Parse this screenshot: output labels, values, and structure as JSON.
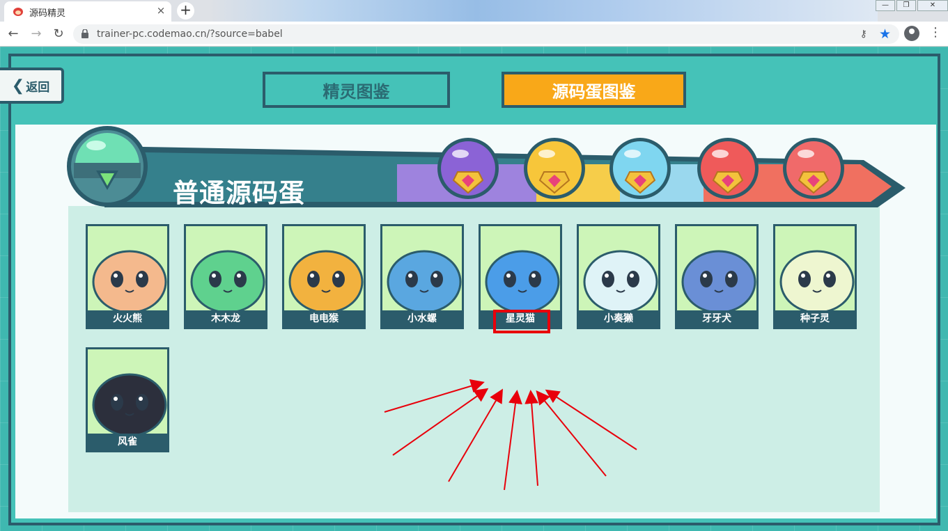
{
  "browser": {
    "tab_title": "源码精灵",
    "tab_close": "×",
    "new_tab": "+",
    "url": "trainer-pc.codemao.cn/?source=babel",
    "win_minimize": "—",
    "win_restore": "❐",
    "win_close": "✕"
  },
  "game": {
    "back_label": "返回",
    "tabs": [
      {
        "label": "精灵图鉴",
        "active": false
      },
      {
        "label": "源码蛋图鉴",
        "active": true
      }
    ],
    "section_title": "普通源码蛋",
    "eggs": [
      {
        "name": "purple-egg",
        "color": "#8b63d6"
      },
      {
        "name": "gold-egg",
        "color": "#f7c63a"
      },
      {
        "name": "rainbow-egg",
        "color": "#7fd6f0"
      },
      {
        "name": "red-egg",
        "color": "#ef5a5a"
      },
      {
        "name": "legend-egg",
        "color": "#f06a6a"
      }
    ],
    "sprites": [
      {
        "label": "火火熊",
        "color": "#f4b98d"
      },
      {
        "label": "木木龙",
        "color": "#5fd18e"
      },
      {
        "label": "电电猴",
        "color": "#f2b23f"
      },
      {
        "label": "小水螺",
        "color": "#5aa7e0"
      },
      {
        "label": "星灵猫",
        "color": "#4b9de8"
      },
      {
        "label": "小奏獭",
        "color": "#dff3f7"
      },
      {
        "label": "牙牙犬",
        "color": "#6a8fd6"
      },
      {
        "label": "种子灵",
        "color": "#eef6d0"
      },
      {
        "label": "风雀",
        "color": "#2c2f3c"
      }
    ],
    "highlighted_sprite": "星灵猫"
  }
}
